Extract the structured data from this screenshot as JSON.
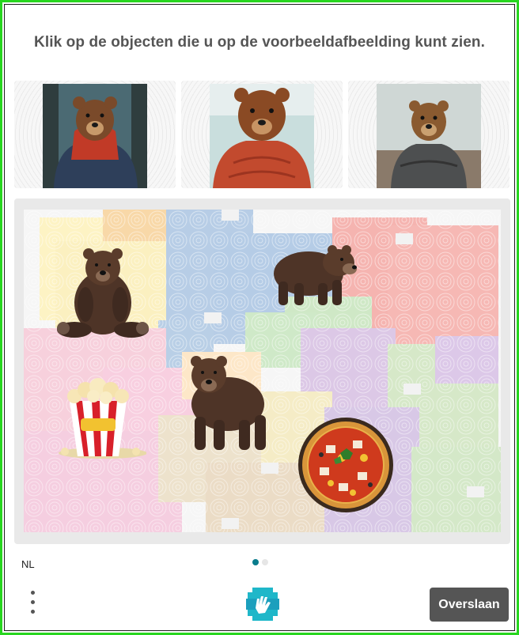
{
  "prompt": {
    "text": "Klik op de objecten die u op de voorbeeldafbeelding kunt zien."
  },
  "examples": [
    {
      "label": "bear-in-red-hoodie-and-puffer-jacket"
    },
    {
      "label": "bear-in-red-puffer-jacket"
    },
    {
      "label": "bear-in-grey-puffer-jacket"
    }
  ],
  "challenge": {
    "objects": [
      "sitting-bear",
      "standing-bear",
      "walking-bear",
      "popcorn",
      "pizza"
    ]
  },
  "footer": {
    "language": "NL",
    "page_count": 2,
    "active_page": 1,
    "skip_label": "Overslaan"
  },
  "colors": {
    "frame_border": "#27d51f",
    "title": "#555555",
    "button_bg": "#555555",
    "dot_active": "#0a7c8c",
    "dot_inactive": "#e6e6e6",
    "logo": "#1fb7c9"
  }
}
